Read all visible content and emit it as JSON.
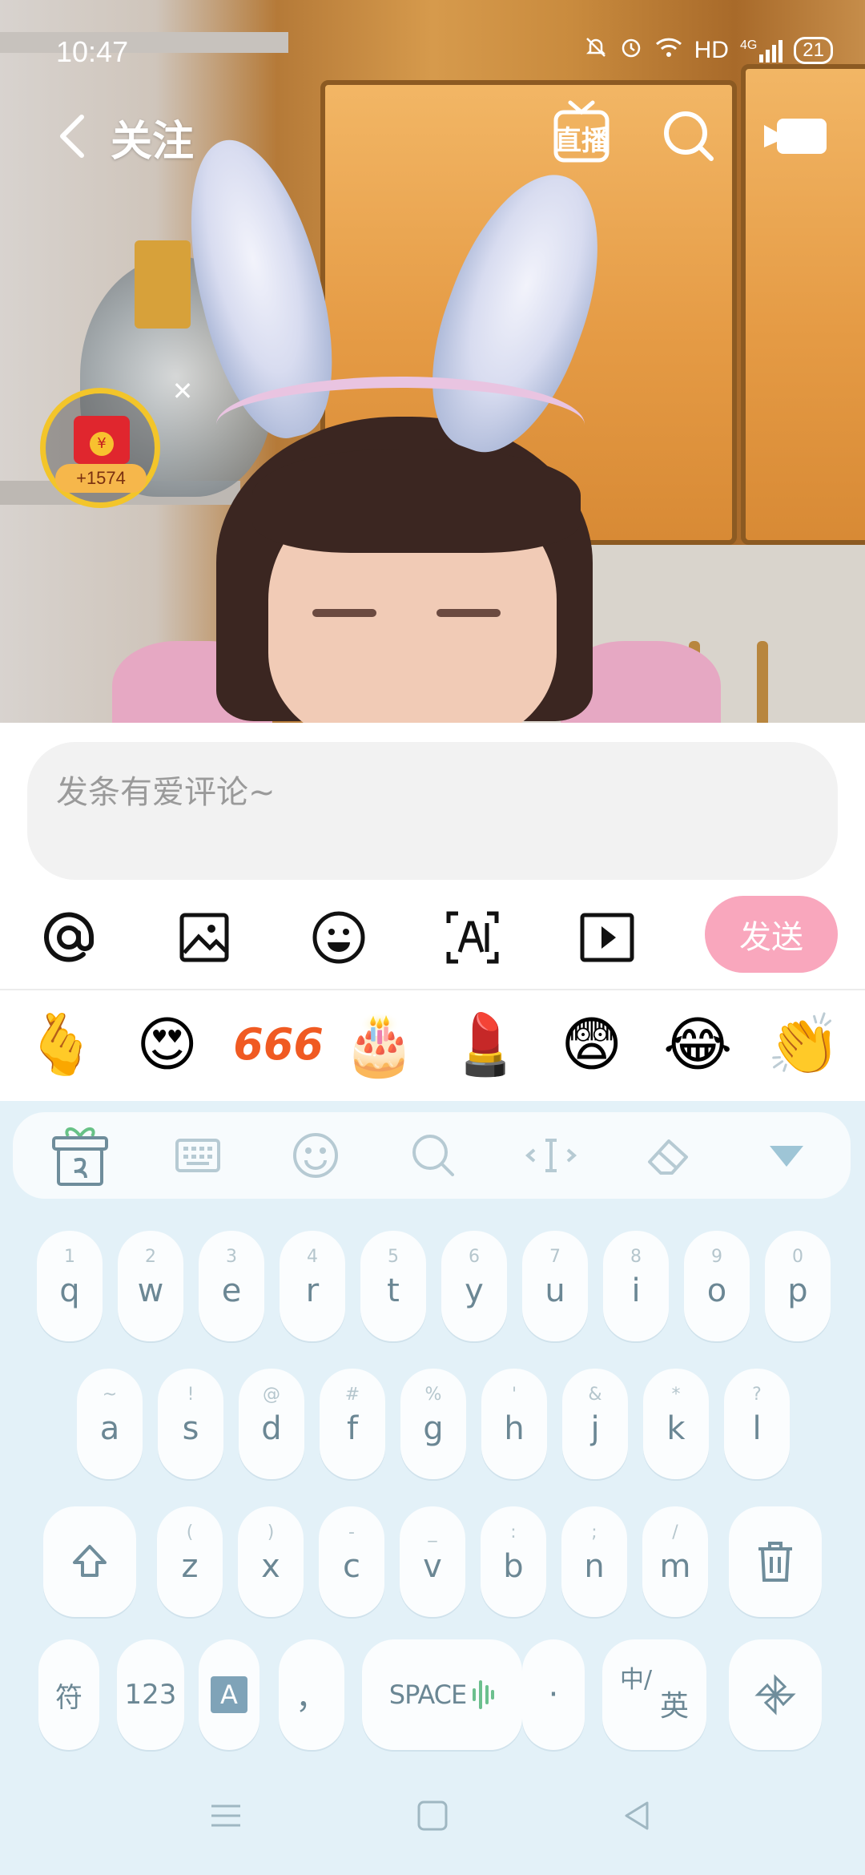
{
  "status_bar": {
    "time": "10:47",
    "network": "HD",
    "network_gen": "4G",
    "battery": "21"
  },
  "top_bar": {
    "title": "关注",
    "live_label": "直播"
  },
  "red_packet": {
    "count": "+1574",
    "coin_glyph": "¥"
  },
  "comment": {
    "placeholder": "发条有爱评论~",
    "send_label": "发送",
    "tools": [
      "mention-icon",
      "image-icon",
      "emoji-icon",
      "ai-text-icon",
      "video-icon"
    ]
  },
  "emojis": [
    "🫰",
    "😍",
    "666",
    "🎂",
    "💄",
    "😨",
    "😂",
    "👏"
  ],
  "keyboard": {
    "toolbar": [
      "gift-icon",
      "keyboard-icon",
      "smile-icon",
      "search-icon",
      "cursor-icon",
      "eraser-icon",
      "collapse-icon"
    ],
    "row1": [
      {
        "hint": "1",
        "key": "q"
      },
      {
        "hint": "2",
        "key": "w"
      },
      {
        "hint": "3",
        "key": "e"
      },
      {
        "hint": "4",
        "key": "r"
      },
      {
        "hint": "5",
        "key": "t"
      },
      {
        "hint": "6",
        "key": "y"
      },
      {
        "hint": "7",
        "key": "u"
      },
      {
        "hint": "8",
        "key": "i"
      },
      {
        "hint": "9",
        "key": "o"
      },
      {
        "hint": "0",
        "key": "p"
      }
    ],
    "row2": [
      {
        "hint": "~",
        "key": "a"
      },
      {
        "hint": "!",
        "key": "s"
      },
      {
        "hint": "@",
        "key": "d"
      },
      {
        "hint": "#",
        "key": "f"
      },
      {
        "hint": "%",
        "key": "g"
      },
      {
        "hint": "'",
        "key": "h"
      },
      {
        "hint": "&",
        "key": "j"
      },
      {
        "hint": "*",
        "key": "k"
      },
      {
        "hint": "?",
        "key": "l"
      }
    ],
    "row3": [
      {
        "hint": "(",
        "key": "z"
      },
      {
        "hint": ")",
        "key": "x"
      },
      {
        "hint": "-",
        "key": "c"
      },
      {
        "hint": "_",
        "key": "v"
      },
      {
        "hint": ":",
        "key": "b"
      },
      {
        "hint": ";",
        "key": "n"
      },
      {
        "hint": "/",
        "key": "m"
      }
    ],
    "symbol_key": "符",
    "number_key": "123",
    "layout_key": "A",
    "comma_key": "，",
    "space_key": "SPACE",
    "period_key": "·",
    "lang_key_top": "中/",
    "lang_key_bottom": "英"
  }
}
